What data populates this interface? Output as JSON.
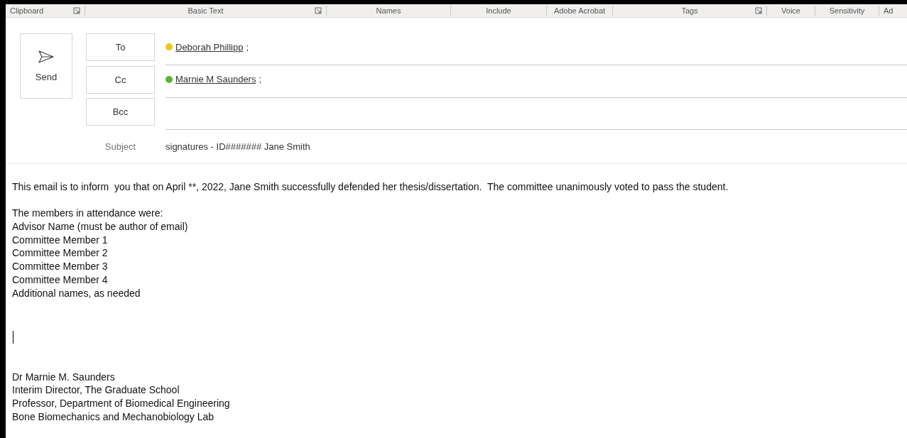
{
  "ribbon_groups": [
    {
      "label": "Clipboard",
      "launcher": true
    },
    {
      "label": "Basic Text",
      "launcher": true
    },
    {
      "label": "Names",
      "launcher": false
    },
    {
      "label": "Include",
      "launcher": false
    },
    {
      "label": "Adobe Acrobat",
      "launcher": false
    },
    {
      "label": "Tags",
      "launcher": true
    },
    {
      "label": "Voice",
      "launcher": false
    },
    {
      "label": "Sensitivity",
      "launcher": false
    },
    {
      "label": "Ad",
      "launcher": false
    }
  ],
  "send_button": {
    "label": "Send"
  },
  "recipients": [
    {
      "label": "To",
      "names": [
        {
          "name": "Deborah Phillipp",
          "separator": ";",
          "color": "#f2c811"
        }
      ]
    },
    {
      "label": "Cc",
      "names": [
        {
          "name": "Marnie M Saunders",
          "separator": ";",
          "color": "#5cb531"
        }
      ]
    },
    {
      "label": "Bcc"
    }
  ],
  "subject": {
    "label": "Subject",
    "value": "signatures - ID####### Jane Smith"
  },
  "body": [
    {
      "kind": "text",
      "text": "This email is to inform  you that on April **, 2022, Jane Smith successfully defended her thesis/dissertation.  The committee unanimously voted to pass the student."
    },
    {
      "kind": "blank"
    },
    {
      "kind": "text",
      "text": "The members in attendance were:"
    },
    {
      "kind": "text",
      "text": "Advisor Name (must be author of email)"
    },
    {
      "kind": "text",
      "text": "Committee Member 1"
    },
    {
      "kind": "text",
      "text": "Committee Member 2"
    },
    {
      "kind": "text",
      "text": "Committee Member 3"
    },
    {
      "kind": "text",
      "text": "Committee Member 4"
    },
    {
      "kind": "text",
      "text": "Additional names, as needed"
    },
    {
      "kind": "blank"
    },
    {
      "kind": "blank"
    },
    {
      "kind": "caret"
    },
    {
      "kind": "blank"
    },
    {
      "kind": "blank"
    },
    {
      "kind": "text",
      "text": "Dr Marnie M. Saunders"
    },
    {
      "kind": "text",
      "text": "Interim Director, The Graduate School"
    },
    {
      "kind": "text",
      "text": "Professor, Department of Biomedical Engineering"
    },
    {
      "kind": "text",
      "text": "Bone Biomechanics and Mechanobiology Lab"
    }
  ]
}
